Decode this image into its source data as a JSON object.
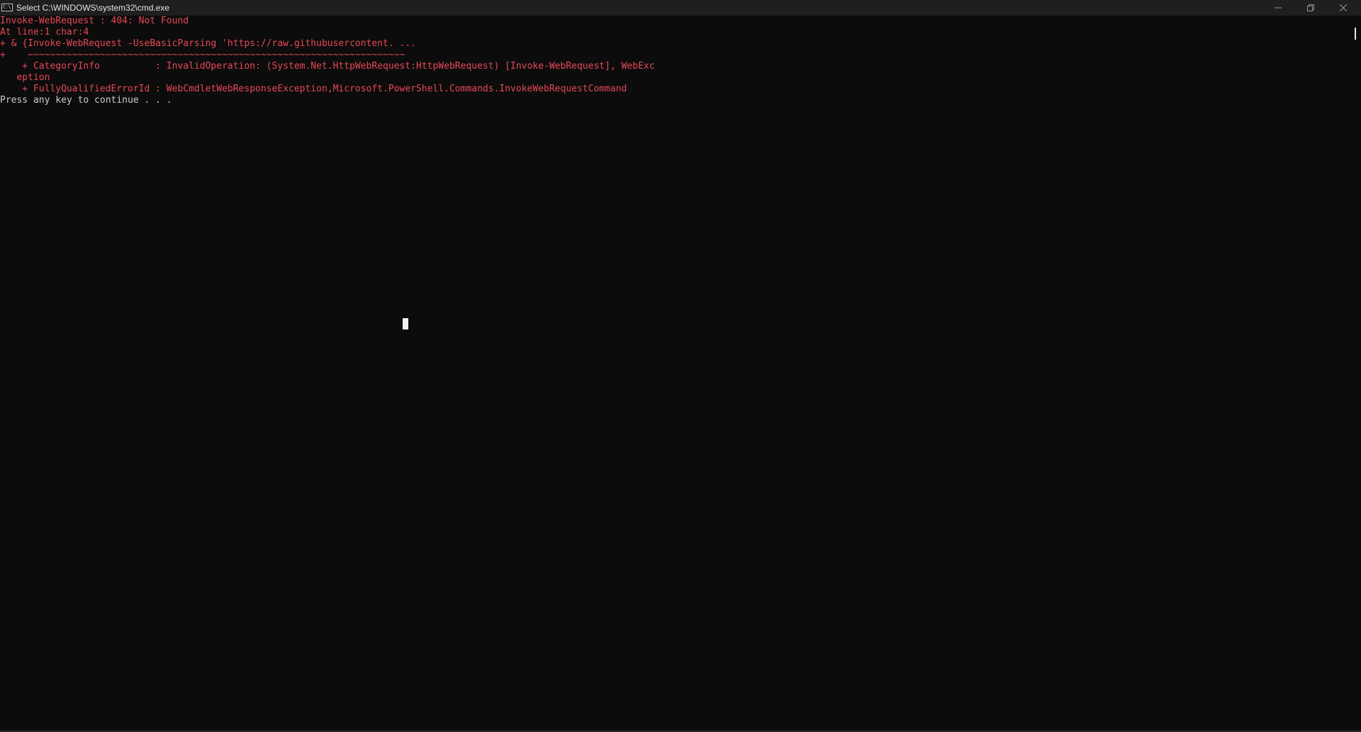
{
  "window": {
    "title": "Select C:\\WINDOWS\\system32\\cmd.exe",
    "icon_label": "C:\\",
    "controls": {
      "minimize": "minimize-icon",
      "maximize": "restore-icon",
      "close": "close-icon"
    }
  },
  "console": {
    "lines": [
      "Invoke-WebRequest : 404: Not Found",
      "At line:1 char:4",
      "+ & {Invoke-WebRequest -UseBasicParsing 'https://raw.githubusercontent. ...",
      "+    ~~~~~~~~~~~~~~~~~~~~~~~~~~~~~~~~~~~~~~~~~~~~~~~~~~~~~~~~~~~~~~~~~~~~",
      "    + CategoryInfo          : InvalidOperation: (System.Net.HttpWebRequest:HttpWebRequest) [Invoke-WebRequest], WebExc",
      "   eption",
      "    + FullyQualifiedErrorId : WebCmdletWebResponseException,Microsoft.PowerShell.Commands.InvokeWebRequestCommand",
      "Press any key to continue . . ."
    ],
    "colors": {
      "background": "#0c0c0c",
      "error_text": "#e74856",
      "normal_text": "#cccccc"
    }
  }
}
